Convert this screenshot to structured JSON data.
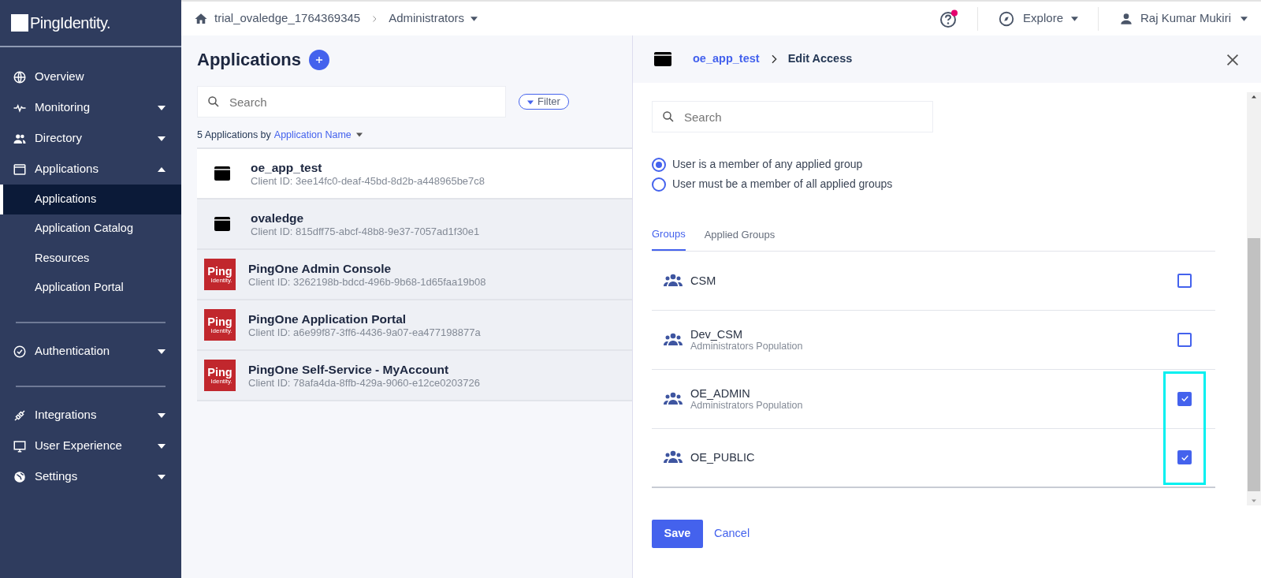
{
  "sidebar": {
    "logo": "**Ping**Identity.",
    "sections": [
      [
        {
          "label": "Overview",
          "selected": false
        },
        {
          "label": "Monitoring",
          "expanded": false,
          "selected": false
        },
        {
          "label": "Directory",
          "expanded": false,
          "selected": false
        },
        {
          "label": "Applications",
          "expanded": true,
          "selected": false,
          "children": [
            {
              "label": "Applications",
              "selected": true
            },
            {
              "label": "Application Catalog",
              "selected": false
            },
            {
              "label": "Resources",
              "selected": false
            },
            {
              "label": "Application Portal",
              "selected": false
            }
          ]
        }
      ],
      [
        {
          "label": "Authentication",
          "expanded": false,
          "selected": false
        }
      ],
      [
        {
          "label": "Integrations",
          "expanded": false,
          "selected": false
        },
        {
          "label": "User Experience",
          "expanded": false,
          "selected": false
        },
        {
          "label": "Settings",
          "expanded": false,
          "selected": false
        }
      ]
    ]
  },
  "top_bar": {
    "breadcrumb": [
      "trial_ovaledge_1764369345",
      "Administrators"
    ],
    "help_notification": true,
    "explore": "Explore",
    "user": "Raj Kumar Mukiri"
  },
  "main": {
    "title": "Applications",
    "search": {
      "placeholder": "Search"
    },
    "filter": "Filter",
    "summary": "5 Applications by",
    "sort": "Application Name",
    "applications": [
      {
        "kind": "generic",
        "name": "oe_app_test",
        "client_id": "Client ID: 3ee14fc0-deaf-45bd-8d2b-a448965be7c8",
        "selected": true
      },
      {
        "kind": "generic",
        "name": "ovaledge",
        "client_id": "Client ID: 815dff75-abcf-48b8-9e37-7057ad1f30e1",
        "selected": false
      },
      {
        "kind": "ping",
        "logo": [
          "Ping",
          "Identity."
        ],
        "name": "PingOne Admin Console",
        "client_id": "Client ID: 3262198b-bdcd-496b-9b68-1d65faa19b08",
        "selected": false
      },
      {
        "kind": "ping",
        "logo": [
          "Ping",
          "Identity."
        ],
        "name": "PingOne Application Portal",
        "client_id": "Client ID: a6e99f87-3ff6-4436-9a07-ea477198877a",
        "selected": false
      },
      {
        "kind": "ping",
        "logo": [
          "Ping",
          "Identity."
        ],
        "name": "PingOne Self-Service - MyAccount",
        "client_id": "Client ID: 78afa4da-8ffb-429a-9060-e12ce0203726",
        "selected": false
      }
    ]
  },
  "panel": {
    "breadcrumb": [
      "oe_app_test",
      "Edit Access"
    ],
    "search": {
      "placeholder": "Search"
    },
    "options": [
      {
        "label": "User is a member of any applied group",
        "selected": true
      },
      {
        "label": "User must be a member of all applied groups",
        "selected": false
      }
    ],
    "tabs": [
      {
        "label": "Groups",
        "selected": true
      },
      {
        "label": "Applied Groups",
        "selected": false
      }
    ],
    "groups": [
      {
        "name": "CSM",
        "checked": false,
        "highlighted": false
      },
      {
        "name": "Dev_CSM",
        "population": "Administrators Population",
        "checked": false,
        "highlighted": false
      },
      {
        "name": "OE_ADMIN",
        "population": "Administrators Population",
        "checked": true,
        "highlighted": true
      },
      {
        "name": "OE_PUBLIC",
        "checked": true,
        "highlighted": true
      }
    ],
    "buttons": {
      "save": "Save",
      "cancel": "Cancel"
    }
  }
}
